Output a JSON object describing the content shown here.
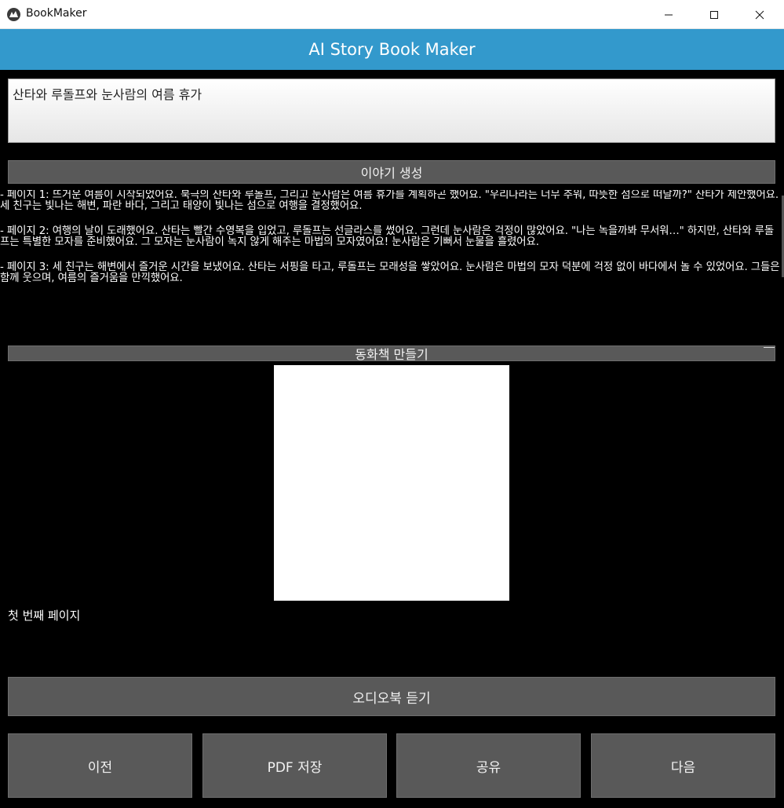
{
  "window": {
    "title": "BookMaker"
  },
  "header": {
    "title": "AI Story Book Maker"
  },
  "topic": {
    "value": "산타와 루돌프와 눈사람의 여름 휴가"
  },
  "buttons": {
    "generate": "이야기 생성",
    "make_book": "동화책 만들기",
    "audio": "오디오북 듣기",
    "prev": "이전",
    "pdf": "PDF 저장",
    "share": "공유",
    "next": "다음"
  },
  "story": {
    "pages": [
      "- 페이지 1: 뜨거운 여름이 시작되었어요. 북극의 산타와 루돌프, 그리고 눈사람은 여름 휴가를 계획하곤 했어요. \"우리나라는 너무 추워, 따뜻한 섬으로 떠날까?\" 산타가 제안했어요. 세 친구는 빛나는 해변, 파란 바다, 그리고 태양이 빛나는 섬으로 여행을 결정했어요.",
      "- 페이지 2: 여행의 날이 도래했어요. 산타는 빨간 수영복을 입었고, 루돌프는 선글라스를 썼어요. 그런데 눈사람은 걱정이 많았어요. \"나는 녹을까봐 무서워…\" 하지만, 산타와 루돌프는 특별한 모자를 준비했어요. 그 모자는 눈사람이 녹지 않게 해주는 마법의 모자였어요! 눈사람은 기뻐서 눈물을 흘렸어요.",
      "- 페이지 3: 세 친구는 해변에서 즐거운 시간을 보냈어요. 산타는 서핑을 타고, 루돌프는 모래성을 쌓았어요. 눈사람은 마법의 모자 덕분에 걱정 없이 바다에서 놀 수 있었어요. 그들은 함께 웃으며, 여름의 즐거움을 만끽했어요."
    ]
  },
  "page": {
    "label": "첫 번째 페이지"
  },
  "colors": {
    "header_bg": "#3399cc",
    "button_bg": "#595959",
    "background": "#000000"
  }
}
